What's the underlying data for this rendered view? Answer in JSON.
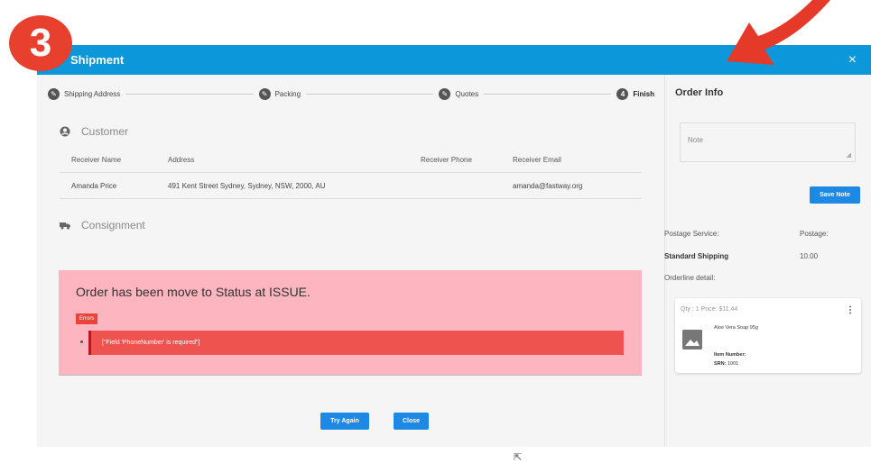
{
  "annotation": {
    "step_number": "3"
  },
  "header": {
    "title": "Shipment",
    "close_icon": "×"
  },
  "stepper": {
    "steps": [
      {
        "label": "Shipping Address",
        "icon": "pencil-icon"
      },
      {
        "label": "Packing",
        "icon": "pencil-icon"
      },
      {
        "label": "Quotes",
        "icon": "pencil-icon"
      },
      {
        "label": "Finish",
        "number": "4"
      }
    ]
  },
  "customer": {
    "title": "Customer",
    "columns": [
      "Receiver Name",
      "Address",
      "Receiver Phone",
      "Receiver Email"
    ],
    "row": [
      "Amanda Price",
      "491 Kent Street Sydney, Sydney, NSW, 2000, AU",
      "",
      "amanda@fastway.org"
    ]
  },
  "consignment": {
    "title": "Consignment",
    "message": "Order has been move to Status at ISSUE.",
    "errors_label": "Errors",
    "error_text": "[\"Field 'PhoneNumber' is required\"]"
  },
  "actions": {
    "try_again": "Try Again",
    "close": "Close"
  },
  "order_info": {
    "title": "Order Info",
    "note_placeholder": "Note",
    "save_note": "Save Note",
    "postage_service_label": "Postage Service:",
    "postage_label": "Postage:",
    "service_value": "Standard Shipping",
    "postage_value": "10.00",
    "orderline_label": "Orderline detail:",
    "item": {
      "qty_price": "Qty : 1 Price: $11.44",
      "name": "Aloe Vera Soap 95g",
      "item_number_label": "Item Number:",
      "srn_label": "SRN:",
      "srn_value": "1001"
    }
  },
  "colors": {
    "header": "#0c97db",
    "alert_bg": "#fdb5bf",
    "error": "#ef5350",
    "button": "#1e88e5",
    "badge": "#e8402f"
  }
}
